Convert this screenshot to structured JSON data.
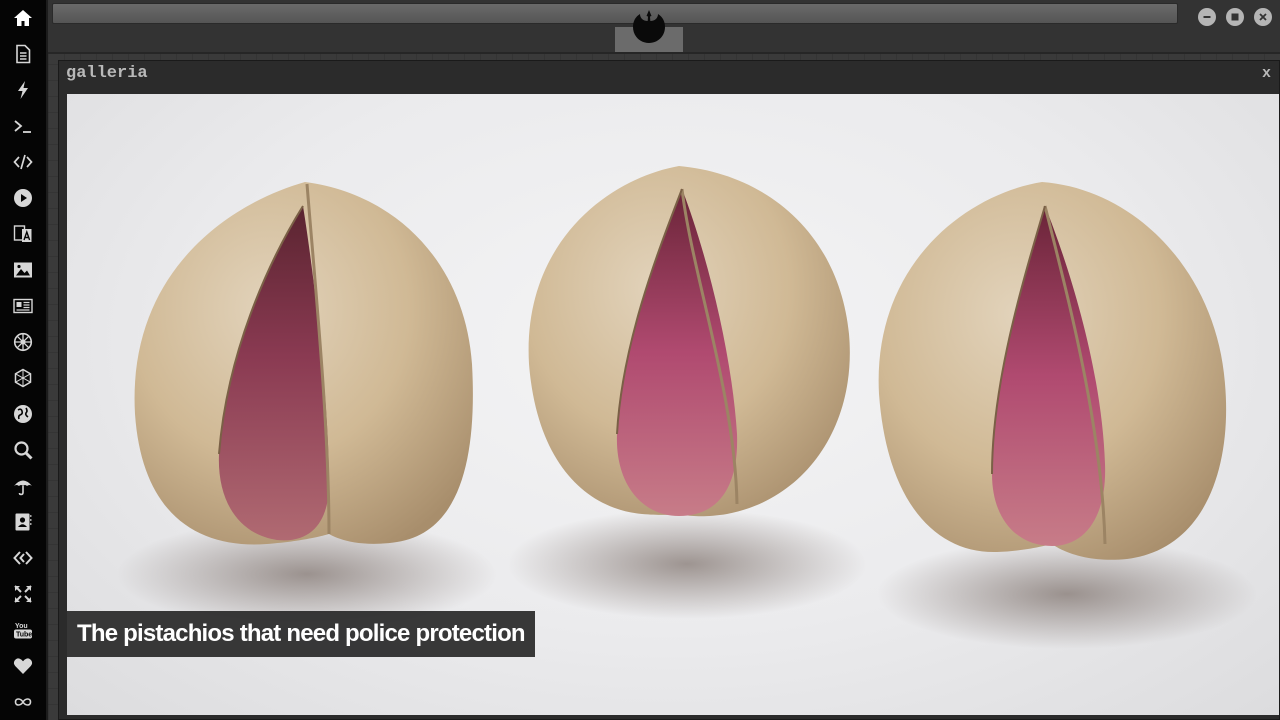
{
  "dock": {
    "items": [
      {
        "name": "home-icon"
      },
      {
        "name": "document-icon"
      },
      {
        "name": "lightning-icon"
      },
      {
        "name": "terminal-icon"
      },
      {
        "name": "code-icon"
      },
      {
        "name": "play-icon"
      },
      {
        "name": "translate-icon"
      },
      {
        "name": "image-icon"
      },
      {
        "name": "news-icon"
      },
      {
        "name": "empire-icon"
      },
      {
        "name": "hexagon-icon"
      },
      {
        "name": "globe-icon"
      },
      {
        "name": "search-icon"
      },
      {
        "name": "umbrella-icon"
      },
      {
        "name": "contacts-icon"
      },
      {
        "name": "diamond-code-icon"
      },
      {
        "name": "expand-icon"
      },
      {
        "name": "youtube-icon"
      },
      {
        "name": "heart-icon"
      },
      {
        "name": "infinity-icon"
      }
    ]
  },
  "window": {
    "title": "galleria",
    "close_label": "x"
  },
  "gallery": {
    "caption": "The pistachios that need police protection"
  },
  "colors": {
    "dock_bg": "#050505",
    "caption_bg": "#282828",
    "caption_text": "#ffffff",
    "kernel": "#8e2a4a",
    "shell": "#d6c1a3"
  }
}
